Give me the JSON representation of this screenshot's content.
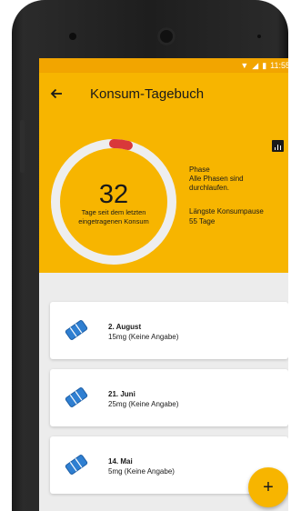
{
  "status": {
    "time": "11:55"
  },
  "appbar": {
    "title": "Konsum-Tagebuch",
    "back_icon": "arrow-left-icon"
  },
  "summary": {
    "days_count": "32",
    "days_caption": "Tage seit dem letzten eingetragenen Konsum",
    "gauge_progress": 0.08,
    "phase_label": "Phase",
    "phase_value": "Alle Phasen sind durchlaufen.",
    "pause_label": "Längste Konsumpause",
    "pause_value": "55 Tage"
  },
  "entries": [
    {
      "date": "2. August",
      "dose": "15mg (Keine Angabe)"
    },
    {
      "date": "21. Juni",
      "dose": "25mg (Keine Angabe)"
    },
    {
      "date": "14. Mai",
      "dose": "5mg (Keine Angabe)"
    }
  ],
  "fab": {
    "label": "+"
  },
  "colors": {
    "primary": "#f7b500",
    "status_bar": "#f2a500",
    "gauge_track": "#eeeeee",
    "gauge_fill": "#d9383a",
    "icon_blue": "#2f7fd1"
  }
}
